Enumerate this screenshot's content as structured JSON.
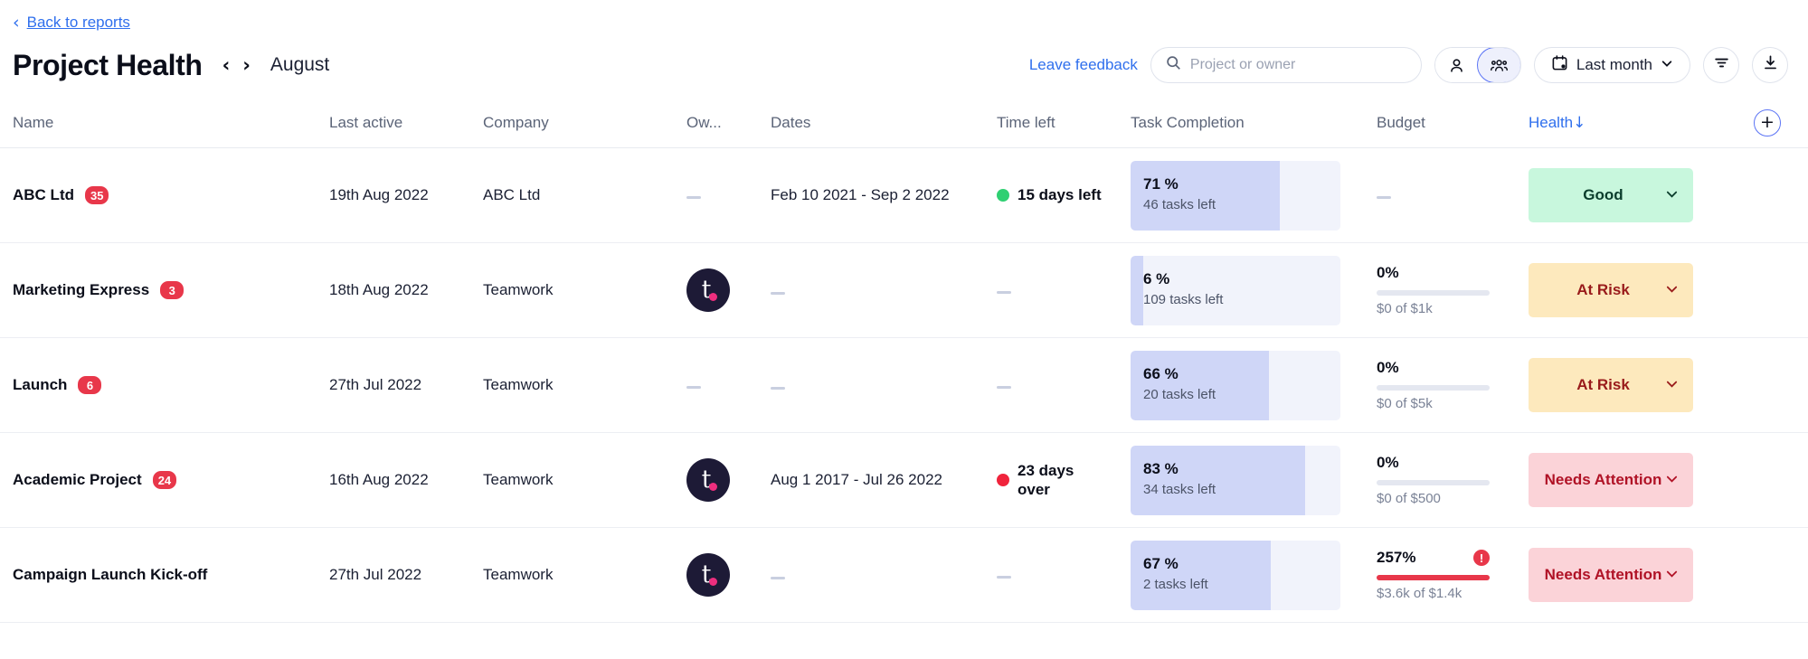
{
  "nav": {
    "back_label": "Back to reports",
    "back_icon": "chevron-left-icon"
  },
  "header": {
    "title": "Project Health",
    "prev_icon": "chevron-left-icon",
    "next_icon": "chevron-right-icon",
    "period": "August",
    "feedback_label": "Leave feedback",
    "search": {
      "placeholder": "Project or owner",
      "value": "",
      "icon": "search-icon"
    },
    "view_toggle": {
      "person_icon": "person-icon",
      "group_icon": "people-group-icon",
      "selected": "group"
    },
    "date_filter": {
      "label": "Last month",
      "icon": "calendar-icon",
      "chevron": "chevron-down-icon"
    },
    "filter_icon": "filter-icon",
    "download_icon": "download-icon"
  },
  "table": {
    "columns": [
      {
        "label": "Name",
        "sorted": false
      },
      {
        "label": "Last active",
        "sorted": false
      },
      {
        "label": "Company",
        "sorted": false
      },
      {
        "label": "Ow...",
        "sorted": false
      },
      {
        "label": "Dates",
        "sorted": false
      },
      {
        "label": "Time left",
        "sorted": false
      },
      {
        "label": "Task Completion",
        "sorted": false
      },
      {
        "label": "Budget",
        "sorted": false
      },
      {
        "label": "Health",
        "sorted": true,
        "sort_direction": "↓"
      }
    ],
    "add_column_label": "+",
    "rows": [
      {
        "name": "ABC Ltd",
        "count": "35",
        "last_active": "19th Aug 2022",
        "company": "ABC Ltd",
        "owner": null,
        "dates": "Feb 10 2021 - Sep 2 2022",
        "time_left": "15 days left",
        "time_status_color": "#2fd072",
        "task_pct_label": "71 %",
        "task_pct_value": 71,
        "tasks_left": "46 tasks left",
        "budget_pct": null,
        "budget_pct_value": 0,
        "budget_sub": null,
        "budget_over": false,
        "health": "Good",
        "health_class": "h-good"
      },
      {
        "name": "Marketing Express",
        "count": "3",
        "last_active": "18th Aug 2022",
        "company": "Teamwork",
        "owner": "teamwork-avatar",
        "dates": null,
        "time_left": null,
        "time_status_color": null,
        "task_pct_label": "6 %",
        "task_pct_value": 6,
        "tasks_left": "109 tasks left",
        "budget_pct": "0%",
        "budget_pct_value": 0,
        "budget_sub": "$0 of $1k",
        "budget_over": false,
        "health": "At Risk",
        "health_class": "h-risk"
      },
      {
        "name": "Launch",
        "count": "6",
        "last_active": "27th Jul 2022",
        "company": "Teamwork",
        "owner": null,
        "dates": null,
        "time_left": null,
        "time_status_color": null,
        "task_pct_label": "66 %",
        "task_pct_value": 66,
        "tasks_left": "20 tasks left",
        "budget_pct": "0%",
        "budget_pct_value": 0,
        "budget_sub": "$0 of $5k",
        "budget_over": false,
        "health": "At Risk",
        "health_class": "h-risk"
      },
      {
        "name": "Academic Project",
        "count": "24",
        "last_active": "16th Aug 2022",
        "company": "Teamwork",
        "owner": "teamwork-avatar",
        "dates": "Aug 1 2017 - Jul 26 2022",
        "time_left": "23 days over",
        "time_status_color": "#f0243c",
        "task_pct_label": "83 %",
        "task_pct_value": 83,
        "tasks_left": "34 tasks left",
        "budget_pct": "0%",
        "budget_pct_value": 0,
        "budget_sub": "$0 of $500",
        "budget_over": false,
        "health": "Needs Attention",
        "health_class": "h-attn"
      },
      {
        "name": "Campaign Launch Kick-off",
        "count": null,
        "last_active": "27th Jul 2022",
        "company": "Teamwork",
        "owner": "teamwork-avatar",
        "dates": null,
        "time_left": null,
        "time_status_color": null,
        "task_pct_label": "67 %",
        "task_pct_value": 67,
        "tasks_left": "2 tasks left",
        "budget_pct": "257%",
        "budget_pct_value": 100,
        "budget_sub": "$3.6k of $1.4k",
        "budget_over": true,
        "budget_warning_icon": "alert-icon",
        "health": "Needs Attention",
        "health_class": "h-attn"
      }
    ]
  },
  "colors": {
    "accent": "#2f6fed",
    "badge_red": "#e8374a",
    "good": "#c8f7dd",
    "at_risk": "#fde9bd",
    "needs_attention": "#fbd3d8",
    "task_fill": "#cfd6f7",
    "task_track": "#f1f3fb"
  }
}
